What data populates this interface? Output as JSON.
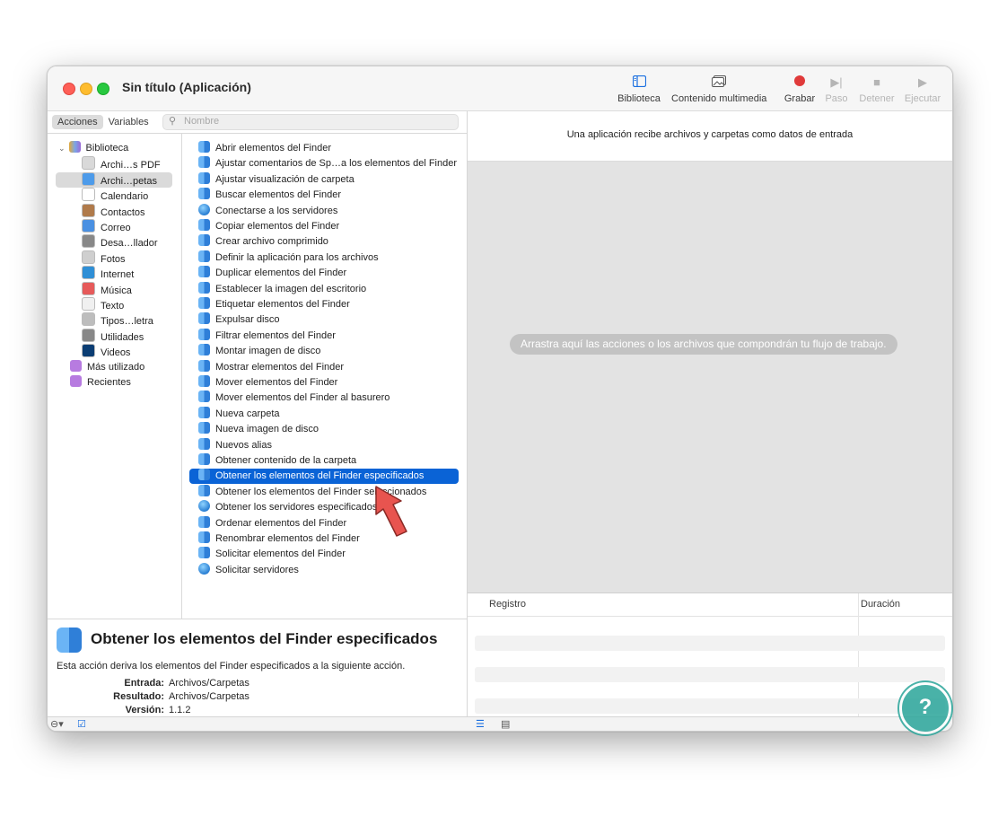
{
  "window": {
    "title": "Sin título (Aplicación)"
  },
  "toolbar": {
    "biblioteca": "Biblioteca",
    "multimedia": "Contenido multimedia",
    "grabar": "Grabar",
    "paso": "Paso",
    "detener": "Detener",
    "ejecutar": "Ejecutar"
  },
  "tabs": {
    "acciones": "Acciones",
    "variables": "Variables"
  },
  "search": {
    "placeholder": "Nombre"
  },
  "library": {
    "root": "Biblioteca",
    "items": [
      "Archi…s PDF",
      "Archi…petas",
      "Calendario",
      "Contactos",
      "Correo",
      "Desa…llador",
      "Fotos",
      "Internet",
      "Música",
      "Texto",
      "Tipos…letra",
      "Utilidades",
      "Videos"
    ],
    "extra": [
      "Más utilizado",
      "Recientes"
    ],
    "selected_index": 1
  },
  "actions": {
    "items": [
      "Abrir elementos del Finder",
      "Ajustar comentarios de Sp…a los elementos del Finder",
      "Ajustar visualización de carpeta",
      "Buscar elementos del Finder",
      "Conectarse a los servidores",
      "Copiar elementos del Finder",
      "Crear archivo comprimido",
      "Definir la aplicación para los archivos",
      "Duplicar elementos del Finder",
      "Establecer la imagen del escritorio",
      "Etiquetar elementos del Finder",
      "Expulsar disco",
      "Filtrar elementos del Finder",
      "Montar imagen de disco",
      "Mostrar elementos del Finder",
      "Mover elementos del Finder",
      "Mover elementos del Finder al basurero",
      "Nueva carpeta",
      "Nueva imagen de disco",
      "Nuevos alias",
      "Obtener contenido de la carpeta",
      "Obtener los elementos del Finder especificados",
      "Obtener los elementos del Finder seleccionados",
      "Obtener los servidores especificados",
      "Ordenar elementos del Finder",
      "Renombrar elementos del Finder",
      "Solicitar elementos del Finder",
      "Solicitar servidores"
    ],
    "selected_index": 21
  },
  "description": {
    "title": "Obtener los elementos del Finder especificados",
    "text": "Esta acción deriva los elementos del Finder especificados a la siguiente acción.",
    "entrada_label": "Entrada:",
    "entrada": "Archivos/Carpetas",
    "resultado_label": "Resultado:",
    "resultado": "Archivos/Carpetas",
    "version_label": "Versión:",
    "version": "1.1.2"
  },
  "workflow": {
    "header": "Una aplicación recibe archivos y carpetas como datos de entrada",
    "drop_message": "Arrastra aquí las acciones o los archivos que compondrán tu flujo de trabajo."
  },
  "log": {
    "col1": "Registro",
    "col2": "Duración"
  },
  "colors": {
    "accent": "#0a63d6",
    "arrow": "#e8544f",
    "record": "#e03a3a"
  }
}
